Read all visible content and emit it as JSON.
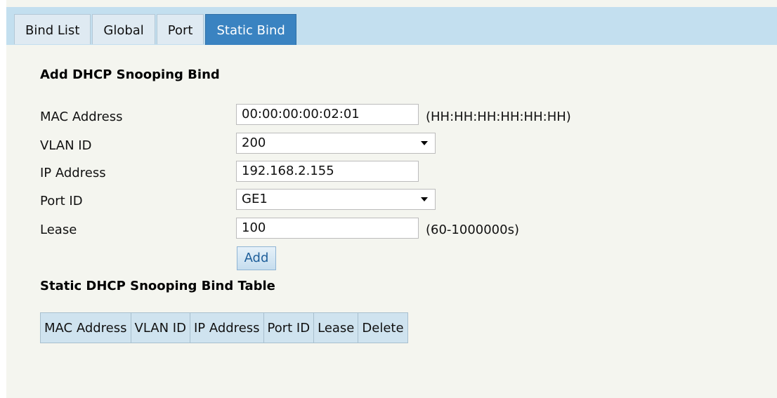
{
  "tabs": [
    {
      "label": "Bind List",
      "active": false
    },
    {
      "label": "Global",
      "active": false
    },
    {
      "label": "Port",
      "active": false
    },
    {
      "label": "Static Bind",
      "active": true
    }
  ],
  "form": {
    "title": "Add DHCP Snooping Bind",
    "mac": {
      "label": "MAC Address",
      "value": "00:00:00:00:02:01",
      "hint": "(HH:HH:HH:HH:HH:HH)"
    },
    "vlan": {
      "label": "VLAN ID",
      "value": "200"
    },
    "ip": {
      "label": "IP Address",
      "value": "192.168.2.155"
    },
    "port": {
      "label": "Port ID",
      "value": "GE1"
    },
    "lease": {
      "label": "Lease",
      "value": "100",
      "hint": "(60-1000000s)"
    },
    "add_label": "Add"
  },
  "table": {
    "title": "Static DHCP Snooping Bind Table",
    "columns": [
      "MAC Address",
      "VLAN ID",
      "IP Address",
      "Port ID",
      "Lease",
      "Delete"
    ]
  },
  "colors": {
    "tab_active": "#3a83c1",
    "tabbar": "#c3dfef",
    "panel": "#f4f5ef",
    "table_header": "#cfe3ef"
  }
}
